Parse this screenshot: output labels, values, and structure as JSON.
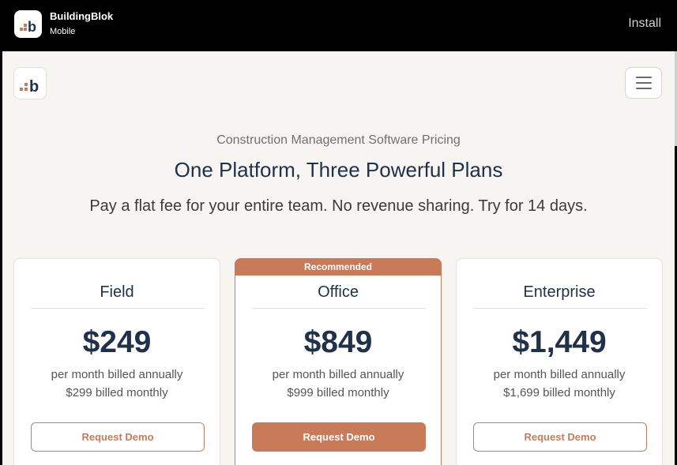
{
  "banner": {
    "app_name": "BuildingBlok",
    "app_subtitle": "Mobile",
    "install_label": "Install",
    "logo_icon": "buildingblok-logo-icon"
  },
  "header": {
    "logo_icon": "buildingblok-logo-icon",
    "menu_icon": "hamburger-menu-icon"
  },
  "hero": {
    "eyebrow": "Construction Management Software Pricing",
    "headline": "One Platform, Three Powerful Plans",
    "subhead": "Pay a flat fee for your entire team. No revenue sharing. Try for 14 days."
  },
  "plans": [
    {
      "name": "Field",
      "price": "$249",
      "billed_annual": "per month billed annually",
      "billed_monthly": "$299 billed monthly",
      "cta": "Request Demo",
      "recommended": false
    },
    {
      "name": "Office",
      "price": "$849",
      "billed_annual": "per month billed annually",
      "billed_monthly": "$999 billed monthly",
      "cta": "Request Demo",
      "recommended": true,
      "badge": "Recommended"
    },
    {
      "name": "Enterprise",
      "price": "$1,449",
      "billed_annual": "per month billed annually",
      "billed_monthly": "$1,699 billed monthly",
      "cta": "Request Demo",
      "recommended": false
    }
  ],
  "colors": {
    "accent": "#c97a59",
    "navy": "#22314a",
    "page_bg": "#f7f5f2"
  }
}
